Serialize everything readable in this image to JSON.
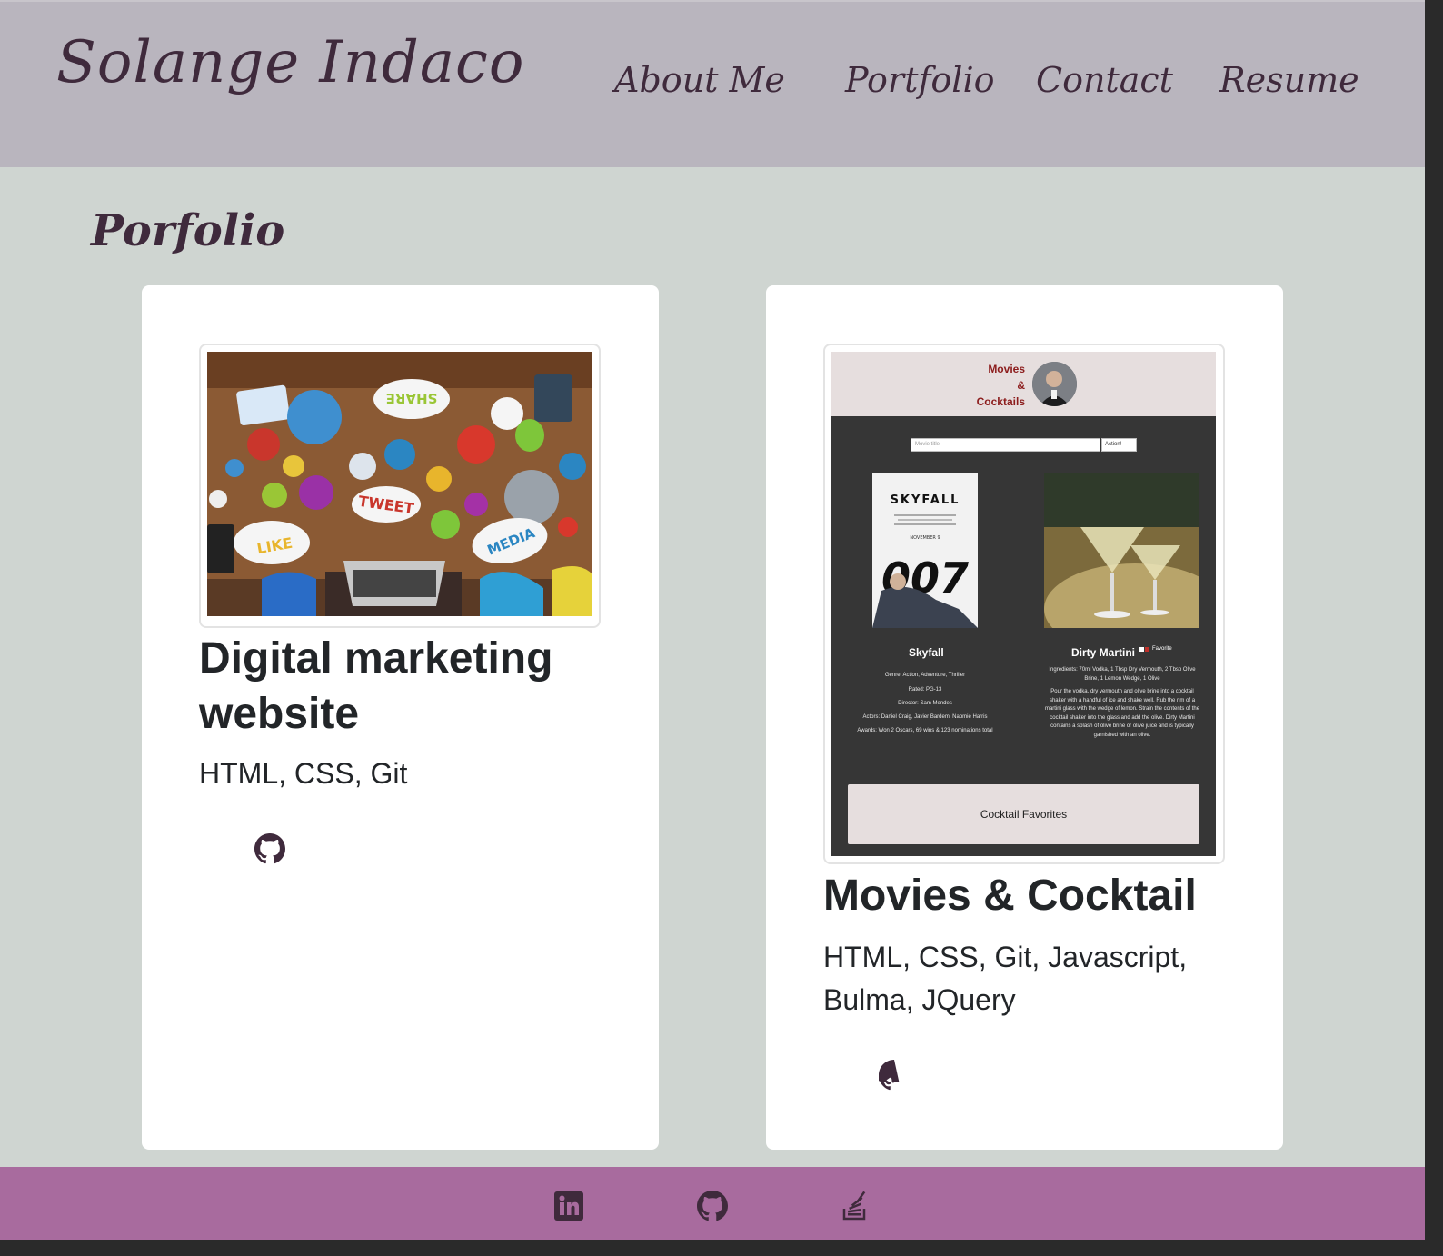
{
  "header": {
    "brand": "Solange Indaco",
    "nav": [
      "About Me",
      "Portfolio",
      "Contact",
      "Resume"
    ]
  },
  "section": {
    "title": "Porfolio"
  },
  "projects": [
    {
      "title": "Digital marketing website",
      "tech": "HTML, CSS, Git",
      "image_labels": [
        "SHARE",
        "TWEET",
        "LIKE",
        "MEDIA"
      ],
      "link_icon": "github-icon"
    },
    {
      "title": "Movies & Cocktail",
      "tech": "HTML, CSS, Git, Javascript, Bulma, JQuery",
      "link_icon": "github-icon",
      "preview": {
        "brand": [
          "Movies",
          "&",
          "Cocktails"
        ],
        "search_placeholder": "Movie title",
        "search_button": "Action!",
        "movie": {
          "poster_title": "SKYFALL",
          "poster_release": "NOVEMBER 9",
          "poster_big": "007",
          "name": "Skyfall",
          "genre": "Genre: Action, Adventure, Thriller",
          "rated": "Rated: PG-13",
          "director": "Director: Sam Mendes",
          "actors": "Actors: Daniel Craig, Javier Bardem, Naomie Harris",
          "awards": "Awards: Won 2 Oscars, 69 wins & 123 nominations total"
        },
        "cocktail": {
          "name": "Dirty Martini",
          "favorite": "Favorite",
          "ingredients": "Ingredients: 70ml Vodka, 1 Tbsp Dry Vermouth, 2 Tbsp Olive Brine, 1 Lemon Wedge, 1 Olive",
          "instructions": "Pour the vodka, dry vermouth and olive brine into a cocktail shaker with a handful of ice and shake well. Rub the rim of a martini glass with the wedge of lemon. Strain the contents of the cocktail shaker into the glass and add the olive. Dirty Martini contains a splash of olive brine or olive juice and is typically garnished with an olive."
        },
        "footer_button": "Cocktail Favorites"
      }
    }
  ],
  "footer": {
    "icons": [
      "linkedin-icon",
      "github-icon",
      "stackoverflow-icon"
    ]
  },
  "colors": {
    "header_bg": "#b9b5be",
    "page_bg": "#cfd5d1",
    "footer_bg": "#a86b9e",
    "brand_text": "#3f2a3c",
    "card_bg": "#ffffff"
  }
}
